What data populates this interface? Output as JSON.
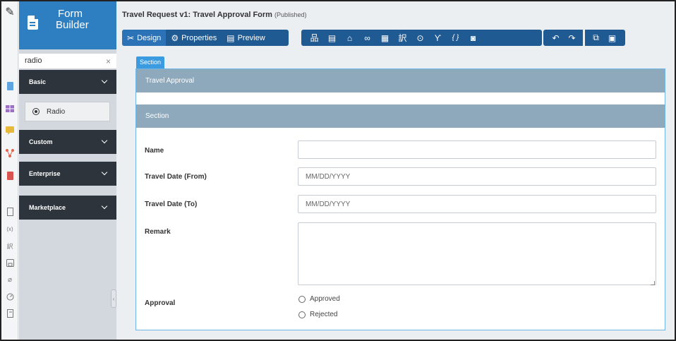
{
  "sidebar": {
    "brand_line1": "Form",
    "brand_line2": "Builder",
    "search_value": "radio",
    "clear_label": "×",
    "categories": [
      "Basic",
      "Custom",
      "Enterprise",
      "Marketplace"
    ],
    "item_label": "Radio"
  },
  "rail_icons": [
    {
      "name": "edit-icon",
      "glyph": "✎"
    },
    {
      "name": "document-icon",
      "color": "#5ea4e0"
    },
    {
      "name": "grid-icon",
      "color": "#9a6fc5"
    },
    {
      "name": "comment-icon",
      "color": "#e6b93a"
    },
    {
      "name": "flow-icon",
      "color": "#e0664d"
    },
    {
      "name": "pdf-icon",
      "color": "#d9534f"
    },
    {
      "name": "page-icon"
    },
    {
      "name": "variable-icon"
    },
    {
      "name": "translate-icon"
    },
    {
      "name": "save-icon"
    },
    {
      "name": "plug-icon"
    },
    {
      "name": "gauge-icon"
    },
    {
      "name": "note-icon"
    }
  ],
  "header": {
    "title": "Travel Request v1: Travel Approval Form",
    "status": "(Published)"
  },
  "toolbar": {
    "design_label": "Design",
    "properties_label": "Properties",
    "preview_label": "Preview",
    "tools": [
      {
        "name": "hierarchy-icon",
        "glyph": "品"
      },
      {
        "name": "form-icon",
        "glyph": "▤"
      },
      {
        "name": "lock-icon",
        "glyph": "⌂"
      },
      {
        "name": "glasses-icon",
        "glyph": "∞"
      },
      {
        "name": "table-icon",
        "glyph": "▦"
      },
      {
        "name": "translate-icon",
        "glyph": "訳"
      },
      {
        "name": "help-icon",
        "glyph": "⊙"
      },
      {
        "name": "branch-icon",
        "glyph": "Ƴ"
      },
      {
        "name": "braces-icon",
        "glyph": "{ }"
      },
      {
        "name": "camera-icon",
        "glyph": "◙"
      }
    ],
    "undo_glyph": "↶",
    "redo_glyph": "↷",
    "copy_glyph": "⧉",
    "paste_glyph": "▣"
  },
  "form": {
    "section_tag": "Section",
    "header_title": "Travel Approval",
    "section_title": "Section",
    "fields": {
      "name_label": "Name",
      "name_value": "",
      "date_from_label": "Travel Date (From)",
      "date_from_placeholder": "MM/DD/YYYY",
      "date_to_label": "Travel Date (To)",
      "date_to_placeholder": "MM/DD/YYYY",
      "remark_label": "Remark",
      "remark_value": "",
      "approval_label": "Approval",
      "options": [
        "Approved",
        "Rejected"
      ]
    }
  },
  "colors": {
    "brand": "#2d7fc1",
    "toolbar": "#1f5a93",
    "category": "#2e343b",
    "section_bar": "#8fa9bc",
    "tag": "#3a9be0"
  }
}
